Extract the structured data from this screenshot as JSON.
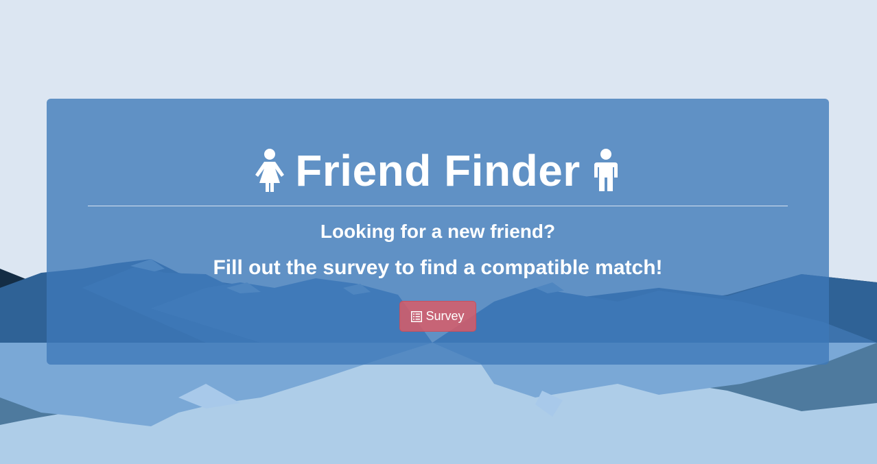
{
  "header": {
    "title": "Friend Finder",
    "left_icon": "female-icon",
    "right_icon": "male-icon"
  },
  "main": {
    "line1": "Looking for a new friend?",
    "line2": "Fill out the survey to find a compatible match!"
  },
  "actions": {
    "survey_label": "Survey",
    "survey_icon": "list-alt-icon"
  },
  "colors": {
    "background_sky": "#dce6f2",
    "panel": "#3e78b8",
    "button": "#de5a64",
    "mountain_dark": "#142d45",
    "lake": "#aecde8"
  }
}
